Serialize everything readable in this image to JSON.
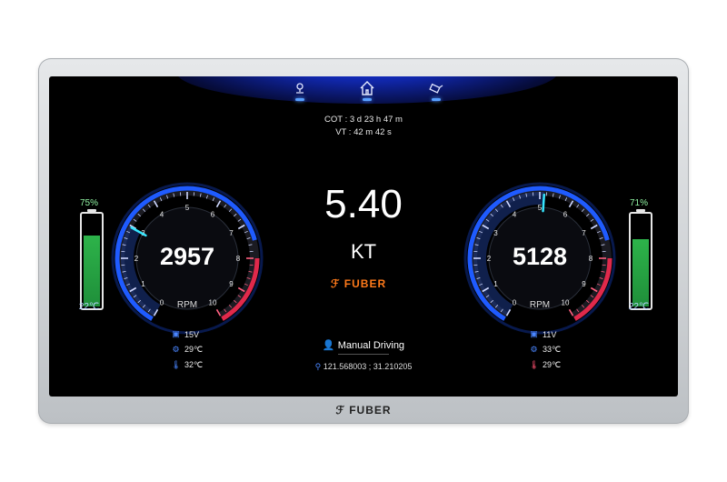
{
  "timers": {
    "cot": "COT : 3 d 23 h 47 m",
    "vt": "VT : 42 m 42 s"
  },
  "nav": {
    "icons": [
      "location-icon",
      "home-icon",
      "camera-icon"
    ]
  },
  "left": {
    "battery_pct": "75%",
    "battery_level": 0.75,
    "temp": "22℃",
    "rpm": "2957",
    "rpm_unit": "RPM",
    "rpm_fraction": 0.296,
    "ticks": [
      "0",
      "1",
      "2",
      "3",
      "4",
      "5",
      "6",
      "7",
      "8",
      "9",
      "10"
    ],
    "stats": [
      {
        "icon": "battery-icon",
        "text": "15V"
      },
      {
        "icon": "engine-icon",
        "text": "29℃"
      },
      {
        "icon": "thermometer-icon",
        "text": "32℃"
      }
    ]
  },
  "right": {
    "battery_pct": "71%",
    "battery_level": 0.71,
    "temp": "22℃",
    "rpm": "5128",
    "rpm_unit": "RPM",
    "rpm_fraction": 0.513,
    "ticks": [
      "0",
      "1",
      "2",
      "3",
      "4",
      "5",
      "6",
      "7",
      "8",
      "9",
      "10"
    ],
    "stats": [
      {
        "icon": "battery-icon",
        "text": "11V"
      },
      {
        "icon": "engine-icon",
        "text": "33℃"
      },
      {
        "icon": "thermometer-icon",
        "text": "29℃"
      }
    ]
  },
  "center": {
    "speed": "5.40",
    "speed_unit": "KT",
    "brand": "FUBER",
    "mode": "Manual Driving",
    "coords": "121.568003 ; 31.210205"
  },
  "footer": {
    "brand": "FUBER"
  },
  "colors": {
    "accent_blue": "#1f5bff",
    "redline": "#e0294b",
    "battery_green": "#2db34a",
    "brand_orange": "#ff7a1a"
  }
}
